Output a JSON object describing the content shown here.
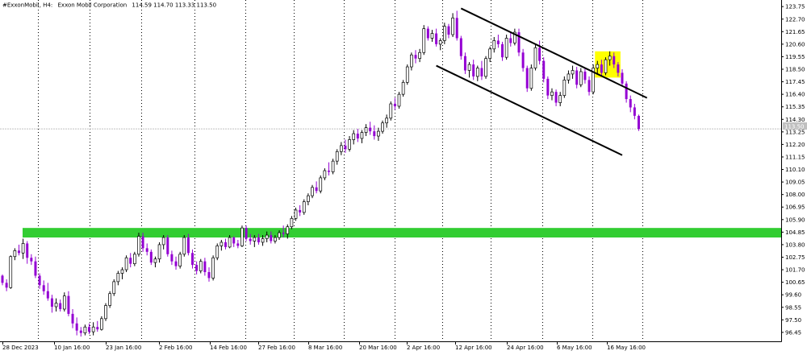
{
  "header": {
    "symbol": "#ExxonMobil, H4:",
    "company": "Exxon Mobil Corporation",
    "ohlc": "114.59 114.70 113.33 113.50"
  },
  "price_label": "113.50",
  "colors": {
    "bull_body": "#ffffff",
    "bull_outline": "#000000",
    "bear_body": "#9400d3",
    "zone": "#32cd32",
    "highlight": "#ffff00",
    "trend": "#000000",
    "grid": "#000000",
    "price_line": "#c0c0c0"
  },
  "chart_data": {
    "type": "candlestick",
    "y_ticks": [
      "123.75",
      "122.70",
      "121.65",
      "120.60",
      "119.55",
      "118.50",
      "117.45",
      "116.40",
      "115.35",
      "114.30",
      "113.25",
      "112.20",
      "111.15",
      "110.10",
      "109.05",
      "108.00",
      "106.95",
      "105.90",
      "104.85",
      "103.80",
      "102.75",
      "101.70",
      "100.65",
      "99.60",
      "98.55",
      "97.50",
      "96.45"
    ],
    "ylim": [
      95.7,
      124.1
    ],
    "x_ticks": [
      "28 Dec 2023",
      "10 Jan 16:00",
      "23 Jan 16:00",
      "2 Feb 16:00",
      "14 Feb 16:00",
      "27 Feb 16:00",
      "8 Mar 16:00",
      "20 Mar 16:00",
      "2 Apr 16:00",
      "12 Apr 16:00",
      "24 Apr 16:00",
      "6 May 16:00",
      "16 May 16:00"
    ],
    "candles": [
      [
        101.2,
        101.3,
        100.4,
        100.6
      ],
      [
        100.6,
        100.9,
        99.9,
        100.2
      ],
      [
        100.2,
        102.9,
        100.1,
        102.8
      ],
      [
        102.8,
        103.5,
        102.5,
        103.3
      ],
      [
        103.3,
        103.8,
        102.9,
        103.1
      ],
      [
        103.1,
        104.3,
        102.6,
        103.9
      ],
      [
        103.9,
        104.1,
        102.2,
        102.7
      ],
      [
        102.7,
        103.0,
        102.1,
        102.4
      ],
      [
        102.4,
        102.8,
        101.0,
        101.2
      ],
      [
        101.2,
        101.4,
        100.1,
        100.4
      ],
      [
        100.4,
        100.8,
        99.6,
        99.9
      ],
      [
        99.9,
        100.6,
        99.1,
        99.3
      ],
      [
        99.3,
        99.6,
        98.1,
        98.6
      ],
      [
        98.6,
        99.3,
        98.2,
        98.9
      ],
      [
        98.9,
        99.2,
        98.2,
        98.4
      ],
      [
        98.4,
        99.8,
        98.2,
        99.5
      ],
      [
        99.5,
        99.9,
        97.8,
        98.0
      ],
      [
        98.0,
        98.4,
        96.8,
        97.2
      ],
      [
        97.2,
        97.7,
        96.2,
        96.6
      ],
      [
        96.6,
        96.9,
        96.1,
        96.4
      ],
      [
        96.4,
        97.1,
        96.2,
        96.9
      ],
      [
        96.9,
        97.2,
        96.3,
        96.5
      ],
      [
        96.5,
        97.3,
        96.2,
        96.9
      ],
      [
        96.9,
        97.4,
        96.5,
        96.7
      ],
      [
        96.7,
        97.8,
        96.6,
        97.6
      ],
      [
        97.6,
        98.9,
        97.4,
        98.7
      ],
      [
        98.7,
        99.9,
        98.5,
        99.7
      ],
      [
        99.7,
        100.9,
        99.5,
        100.7
      ],
      [
        100.7,
        101.6,
        100.4,
        101.4
      ],
      [
        101.4,
        101.9,
        100.9,
        101.7
      ],
      [
        101.7,
        102.9,
        101.5,
        102.7
      ],
      [
        102.7,
        103.1,
        101.9,
        102.2
      ],
      [
        102.2,
        103.2,
        102.0,
        103.0
      ],
      [
        103.0,
        104.8,
        102.8,
        104.5
      ],
      [
        104.5,
        104.8,
        103.2,
        103.5
      ],
      [
        103.5,
        103.9,
        102.9,
        103.2
      ],
      [
        103.2,
        103.4,
        102.1,
        102.3
      ],
      [
        102.3,
        102.8,
        101.9,
        102.6
      ],
      [
        102.6,
        104.0,
        102.3,
        103.8
      ],
      [
        103.8,
        104.6,
        103.4,
        104.4
      ],
      [
        104.4,
        104.6,
        102.8,
        103.0
      ],
      [
        103.0,
        103.3,
        102.1,
        102.4
      ],
      [
        102.4,
        102.8,
        101.7,
        102.0
      ],
      [
        102.0,
        103.2,
        101.8,
        103.0
      ],
      [
        103.0,
        104.6,
        102.8,
        104.4
      ],
      [
        104.4,
        104.7,
        102.9,
        103.1
      ],
      [
        103.1,
        103.4,
        101.8,
        102.1
      ],
      [
        102.1,
        102.4,
        101.3,
        101.6
      ],
      [
        101.6,
        102.6,
        101.4,
        102.4
      ],
      [
        102.4,
        102.7,
        101.2,
        101.5
      ],
      [
        101.5,
        101.9,
        100.7,
        101.0
      ],
      [
        101.0,
        102.9,
        100.8,
        102.7
      ],
      [
        102.7,
        103.9,
        102.5,
        103.7
      ],
      [
        103.7,
        104.2,
        103.3,
        104.0
      ],
      [
        104.0,
        104.3,
        103.4,
        103.6
      ],
      [
        103.6,
        104.6,
        103.5,
        104.4
      ],
      [
        104.4,
        104.5,
        103.6,
        103.9
      ],
      [
        103.9,
        104.2,
        103.5,
        103.7
      ],
      [
        103.7,
        105.4,
        103.6,
        105.2
      ],
      [
        105.2,
        105.4,
        104.1,
        104.3
      ],
      [
        104.3,
        104.7,
        103.8,
        104.1
      ],
      [
        104.1,
        104.6,
        103.6,
        104.4
      ],
      [
        104.4,
        104.7,
        103.8,
        104.0
      ],
      [
        104.0,
        104.6,
        103.7,
        104.3
      ],
      [
        104.3,
        104.9,
        104.0,
        104.6
      ],
      [
        104.6,
        104.9,
        103.9,
        104.1
      ],
      [
        104.1,
        104.6,
        103.9,
        104.4
      ],
      [
        104.4,
        105.0,
        104.2,
        104.8
      ],
      [
        104.8,
        105.4,
        104.4,
        104.7
      ],
      [
        104.7,
        105.5,
        104.3,
        105.3
      ],
      [
        105.3,
        106.2,
        105.1,
        106.0
      ],
      [
        106.0,
        106.9,
        105.8,
        106.7
      ],
      [
        106.7,
        107.1,
        106.2,
        106.5
      ],
      [
        106.5,
        107.6,
        106.3,
        107.4
      ],
      [
        107.4,
        108.1,
        107.1,
        107.9
      ],
      [
        107.9,
        108.8,
        107.7,
        108.6
      ],
      [
        108.6,
        109.1,
        108.1,
        108.3
      ],
      [
        108.3,
        109.6,
        108.1,
        109.4
      ],
      [
        109.4,
        110.2,
        109.2,
        110.0
      ],
      [
        110.0,
        110.7,
        109.6,
        109.9
      ],
      [
        109.9,
        111.0,
        109.7,
        110.8
      ],
      [
        110.8,
        111.8,
        110.5,
        111.6
      ],
      [
        111.6,
        112.4,
        111.3,
        112.1
      ],
      [
        112.1,
        112.6,
        111.5,
        111.8
      ],
      [
        111.8,
        112.9,
        111.6,
        112.6
      ],
      [
        112.6,
        113.4,
        112.2,
        113.1
      ],
      [
        113.1,
        113.5,
        112.4,
        112.7
      ],
      [
        112.7,
        113.4,
        112.3,
        113.2
      ],
      [
        113.2,
        113.9,
        112.9,
        113.6
      ],
      [
        113.6,
        114.1,
        113.0,
        113.3
      ],
      [
        113.3,
        113.8,
        112.6,
        112.9
      ],
      [
        112.9,
        113.6,
        112.5,
        113.3
      ],
      [
        113.3,
        114.2,
        113.1,
        114.0
      ],
      [
        114.0,
        114.7,
        113.6,
        114.4
      ],
      [
        114.4,
        115.8,
        114.2,
        115.6
      ],
      [
        115.6,
        116.1,
        115.1,
        115.4
      ],
      [
        115.4,
        116.6,
        115.2,
        116.4
      ],
      [
        116.4,
        117.6,
        116.2,
        117.4
      ],
      [
        117.4,
        118.9,
        117.2,
        118.7
      ],
      [
        118.7,
        119.9,
        118.4,
        119.7
      ],
      [
        119.7,
        120.1,
        119.0,
        119.4
      ],
      [
        119.4,
        120.2,
        119.1,
        119.9
      ],
      [
        119.9,
        122.2,
        119.7,
        121.9
      ],
      [
        121.9,
        122.1,
        120.9,
        121.1
      ],
      [
        121.1,
        121.8,
        120.8,
        121.5
      ],
      [
        121.5,
        121.9,
        120.4,
        120.6
      ],
      [
        120.6,
        121.1,
        120.1,
        120.9
      ],
      [
        120.9,
        122.4,
        120.6,
        122.1
      ],
      [
        122.1,
        122.3,
        121.1,
        121.4
      ],
      [
        121.4,
        123.2,
        121.2,
        122.8
      ],
      [
        122.8,
        123.4,
        120.9,
        121.1
      ],
      [
        121.1,
        121.3,
        119.3,
        119.6
      ],
      [
        119.6,
        119.9,
        118.1,
        118.4
      ],
      [
        118.4,
        119.1,
        117.8,
        118.9
      ],
      [
        118.9,
        119.3,
        117.6,
        117.9
      ],
      [
        117.9,
        118.8,
        117.5,
        118.6
      ],
      [
        118.6,
        119.2,
        117.6,
        117.9
      ],
      [
        117.9,
        119.6,
        117.7,
        119.4
      ],
      [
        119.4,
        120.4,
        119.1,
        120.2
      ],
      [
        120.2,
        121.2,
        119.9,
        120.9
      ],
      [
        120.9,
        121.4,
        120.3,
        120.6
      ],
      [
        120.6,
        120.8,
        119.2,
        119.5
      ],
      [
        119.5,
        121.4,
        119.3,
        121.1
      ],
      [
        121.1,
        121.6,
        120.4,
        120.7
      ],
      [
        120.7,
        121.9,
        120.5,
        121.6
      ],
      [
        121.6,
        121.9,
        119.6,
        119.9
      ],
      [
        119.9,
        120.2,
        118.3,
        118.6
      ],
      [
        118.6,
        118.8,
        116.6,
        116.9
      ],
      [
        116.9,
        118.9,
        116.7,
        118.6
      ],
      [
        118.6,
        120.6,
        118.4,
        120.3
      ],
      [
        120.3,
        120.9,
        118.9,
        119.2
      ],
      [
        119.2,
        119.5,
        117.4,
        117.7
      ],
      [
        117.7,
        117.9,
        116.0,
        116.3
      ],
      [
        116.3,
        116.9,
        115.9,
        116.6
      ],
      [
        116.6,
        116.8,
        115.4,
        115.7
      ],
      [
        115.7,
        116.6,
        115.4,
        116.3
      ],
      [
        116.3,
        117.9,
        116.1,
        117.6
      ],
      [
        117.6,
        118.4,
        117.3,
        118.1
      ],
      [
        118.1,
        118.8,
        117.7,
        118.4
      ],
      [
        118.4,
        118.7,
        116.9,
        117.2
      ],
      [
        117.2,
        118.6,
        117.0,
        118.3
      ],
      [
        118.3,
        118.6,
        117.3,
        117.6
      ],
      [
        117.6,
        117.9,
        116.3,
        116.6
      ],
      [
        116.6,
        118.9,
        116.4,
        118.6
      ],
      [
        118.6,
        119.2,
        118.1,
        118.9
      ],
      [
        118.9,
        119.3,
        117.9,
        118.2
      ],
      [
        118.2,
        119.5,
        118.0,
        119.3
      ],
      [
        119.3,
        120.0,
        118.8,
        119.6
      ],
      [
        119.6,
        119.9,
        118.6,
        118.9
      ],
      [
        118.9,
        119.1,
        117.9,
        118.2
      ],
      [
        118.2,
        118.5,
        117.1,
        117.3
      ],
      [
        117.3,
        117.5,
        115.7,
        116.0
      ],
      [
        116.0,
        116.3,
        114.9,
        115.3
      ],
      [
        115.3,
        115.6,
        114.3,
        114.6
      ],
      [
        114.59,
        114.7,
        113.33,
        113.5
      ]
    ],
    "zones": [
      {
        "from": 104.4,
        "to": 105.2
      }
    ],
    "price_line": 113.5,
    "highlight_box": {
      "candles": [
        144,
        149
      ],
      "from": 117.8,
      "to": 120.0
    },
    "trendlines": [
      {
        "from": [
          111,
          123.6
        ],
        "to": [
          156,
          116.1
        ]
      },
      {
        "from": [
          105,
          118.8
        ],
        "to": [
          150,
          111.3
        ]
      }
    ]
  }
}
